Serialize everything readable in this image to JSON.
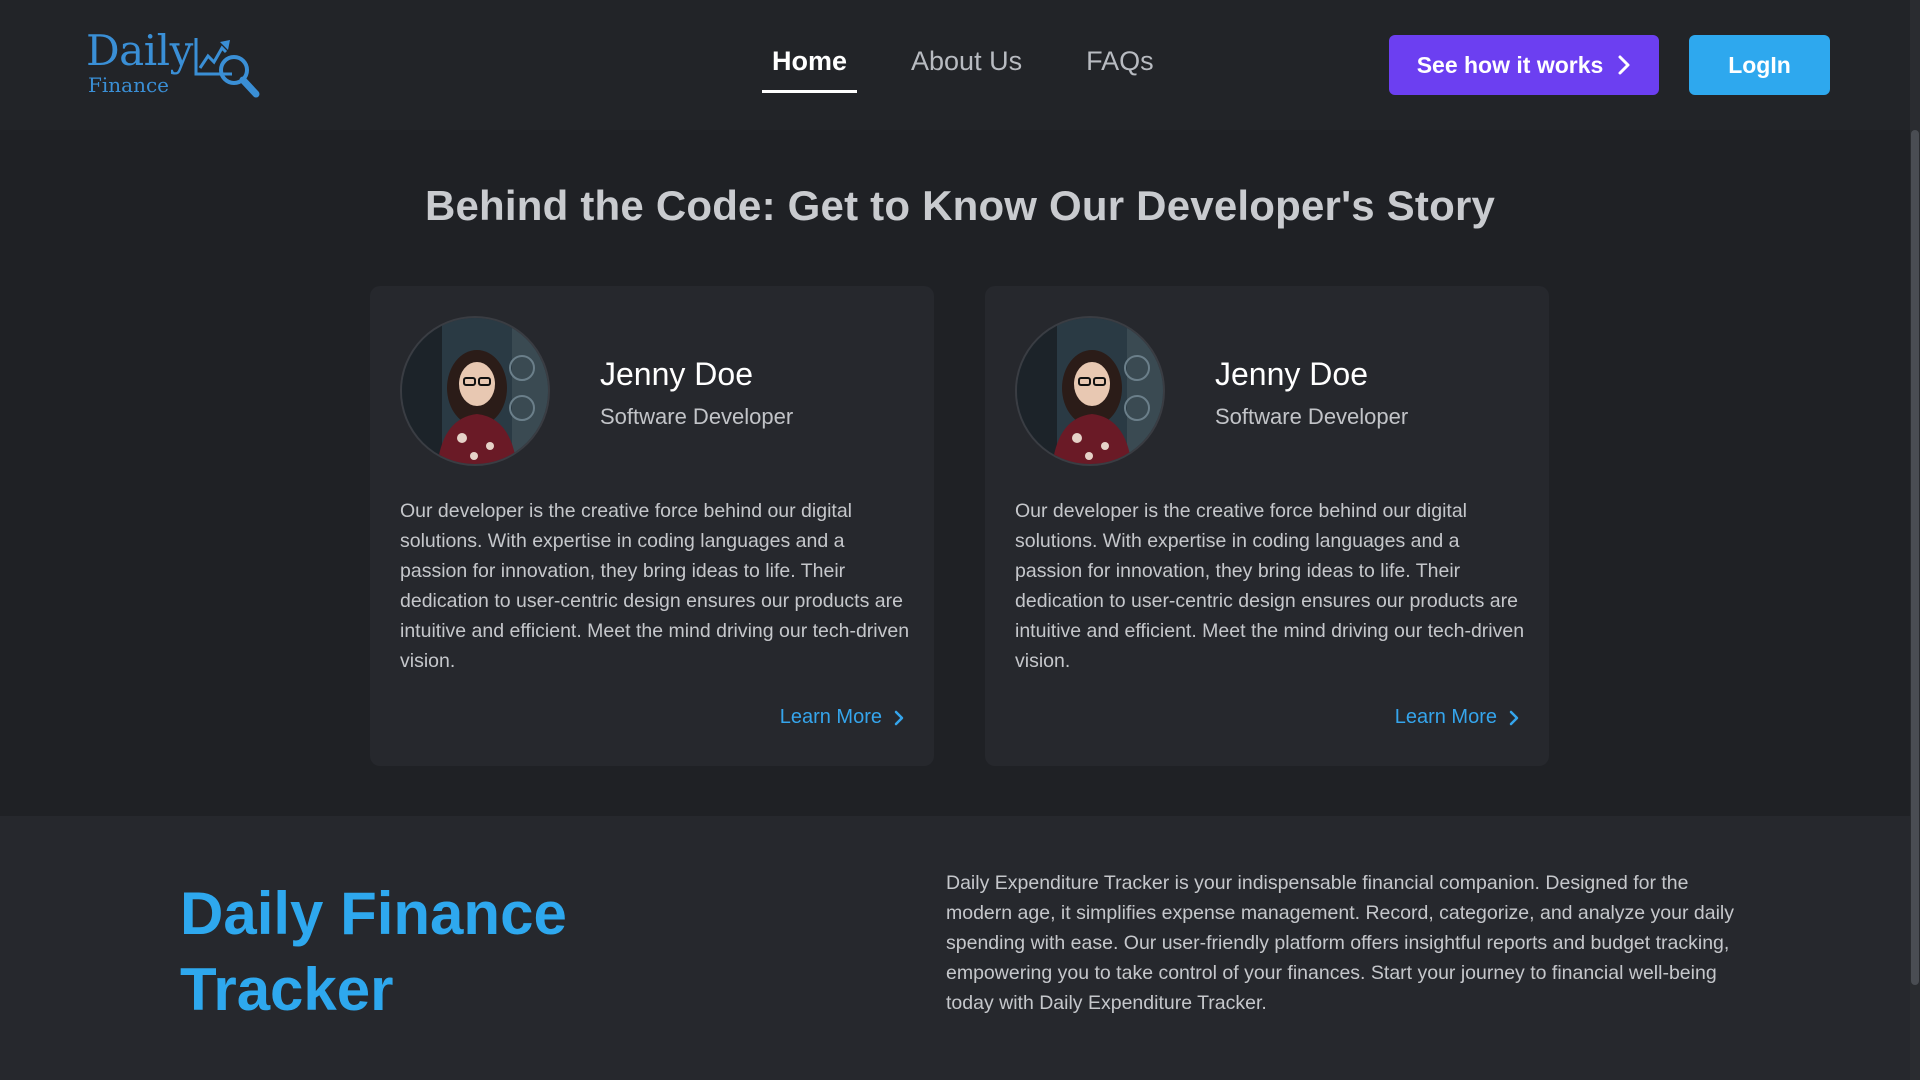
{
  "header": {
    "logo_word": "Daily",
    "logo_sub": "Finance",
    "nav": [
      {
        "label": "Home",
        "active": true
      },
      {
        "label": "About Us",
        "active": false
      },
      {
        "label": "FAQs",
        "active": false
      }
    ],
    "how_button": "See how it works",
    "login_button": "LogIn"
  },
  "developers": {
    "title": "Behind the Code: Get to Know Our Developer's Story",
    "cards": [
      {
        "name": "Jenny Doe",
        "role": "Software Developer",
        "description": "Our developer is the creative force behind our digital solutions. With expertise in coding languages and a passion for innovation, they bring ideas to life. Their dedication to user-centric design ensures our products are intuitive and efficient. Meet the mind driving our tech-driven vision.",
        "link": "Learn More"
      },
      {
        "name": "Jenny Doe",
        "role": "Software Developer",
        "description": "Our developer is the creative force behind our digital solutions. With expertise in coding languages and a passion for innovation, they bring ideas to life. Their dedication to user-centric design ensures our products are intuitive and efficient. Meet the mind driving our tech-driven vision.",
        "link": "Learn More"
      }
    ]
  },
  "footer": {
    "title": "Daily Finance Tracker",
    "description": "Daily Expenditure Tracker is your indispensable financial companion. Designed for the modern age, it simplifies expense management. Record, categorize, and analyze your daily spending with ease. Our user-friendly platform offers insightful reports and budget tracking, empowering you to take control of your finances. Start your journey to financial well-being today with Daily Expenditure Tracker."
  },
  "colors": {
    "background": "#1f2125",
    "card": "#26282d",
    "accent_blue": "#2ea8ee",
    "accent_purple": "#6c3ff1"
  }
}
